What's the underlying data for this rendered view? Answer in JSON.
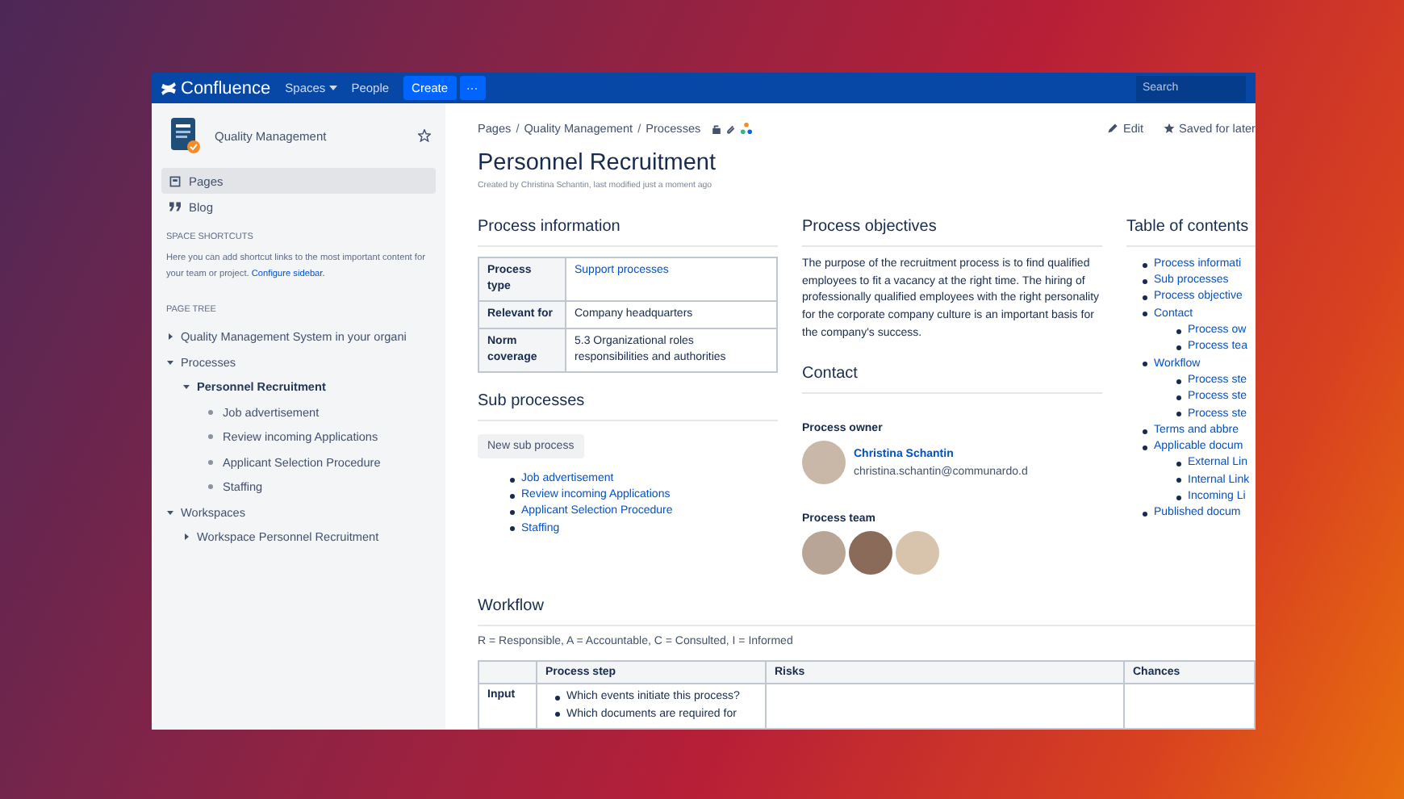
{
  "topbar": {
    "logo": "Confluence",
    "nav": [
      {
        "label": "Spaces",
        "dropdown": true
      },
      {
        "label": "People",
        "dropdown": false
      }
    ],
    "create": "Create",
    "more": "···",
    "search": {
      "placeholder": "Search"
    }
  },
  "sidebar": {
    "space_name": "Quality Management",
    "starred": false,
    "nav": [
      {
        "label": "Pages",
        "kind": "pages",
        "selected": true
      },
      {
        "label": "Blog",
        "kind": "blog",
        "selected": false
      }
    ],
    "shortcuts_heading": "SPACE SHORTCUTS",
    "shortcuts_text": "Here you can add shortcut links to the most important content for your team or project.",
    "configure_link": "Configure sidebar.",
    "tree_heading": "PAGE TREE",
    "tree": [
      {
        "label": "Quality Management System in your organi",
        "kind": "branch",
        "expanded": false,
        "selected": false
      },
      {
        "label": "Processes",
        "kind": "branch",
        "expanded": true,
        "selected": false,
        "children": [
          {
            "label": "Personnel Recruitment",
            "kind": "branch",
            "expanded": true,
            "selected": true,
            "children": [
              {
                "label": "Job advertisement",
                "kind": "leaf",
                "expanded": false,
                "selected": false
              },
              {
                "label": "Review incoming Applications",
                "kind": "leaf",
                "expanded": false,
                "selected": false
              },
              {
                "label": "Applicant Selection Procedure",
                "kind": "leaf",
                "expanded": false,
                "selected": false
              },
              {
                "label": "Staffing",
                "kind": "leaf",
                "expanded": false,
                "selected": false
              }
            ]
          }
        ]
      },
      {
        "label": "Workspaces",
        "kind": "branch",
        "expanded": true,
        "selected": false,
        "children": [
          {
            "label": "Workspace Personnel Recruitment",
            "kind": "branch",
            "expanded": false,
            "selected": false
          }
        ]
      }
    ]
  },
  "page": {
    "breadcrumbs": [
      {
        "label": "Pages",
        "kind": "link"
      },
      {
        "label": "/",
        "kind": "separator"
      },
      {
        "label": "Quality Management",
        "kind": "link"
      },
      {
        "label": "/",
        "kind": "separator"
      },
      {
        "label": "Processes",
        "kind": "link"
      }
    ],
    "actions": [
      {
        "label": "Edit",
        "kind": "edit"
      },
      {
        "label": "Saved for later",
        "kind": "saved"
      }
    ],
    "title": "Personnel Recruitment",
    "byline": "Created by Christina Schantin, last modified just a moment ago",
    "process_information": {
      "heading": "Process information",
      "rows": [
        {
          "label": "Process type",
          "value": "Support processes",
          "link": true
        },
        {
          "label": "Relevant for",
          "value": "Company headquarters",
          "link": false
        },
        {
          "label": "Norm coverage",
          "value": "5.3 Organizational roles responsibilities and authorities",
          "link": false
        }
      ]
    },
    "sub_processes": {
      "heading": "Sub processes",
      "button": "New sub process",
      "items": [
        "Job advertisement",
        "Review incoming Applications",
        "Applicant Selection Procedure",
        "Staffing"
      ]
    },
    "objectives": {
      "heading": "Process objectives",
      "text": "The purpose of the recruitment process is to find qualified employees to fit a vacancy at the right time. The hiring of professionally qualified employees with the right personality for the corporate company culture is an important basis for the company's success."
    },
    "contact": {
      "heading": "Contact",
      "owner_label": "Process owner",
      "owner_name": "Christina Schantin",
      "owner_email": "christina.schantin@communardo.d",
      "team_label": "Process team"
    },
    "toc": {
      "heading": "Table of contents",
      "items": [
        {
          "label": "Process informati"
        },
        {
          "label": "Sub processes"
        },
        {
          "label": "Process objective"
        },
        {
          "label": "Contact",
          "children": [
            {
              "label": "Process ow"
            },
            {
              "label": "Process tea"
            }
          ]
        },
        {
          "label": "Workflow",
          "children": [
            {
              "label": "Process ste"
            },
            {
              "label": "Process ste"
            },
            {
              "label": "Process ste"
            }
          ]
        },
        {
          "label": "Terms and abbre"
        },
        {
          "label": "Applicable docum",
          "children": [
            {
              "label": "External Lin"
            },
            {
              "label": "Internal Link"
            },
            {
              "label": "Incoming Li"
            }
          ]
        },
        {
          "label": "Published docum"
        }
      ]
    },
    "workflow": {
      "heading": "Workflow",
      "legend": "R = Responsible, A = Accountable, C = Consulted, I = Informed",
      "columns": [
        "Process step",
        "Risks",
        "Chances"
      ],
      "rows": [
        {
          "label": "Input",
          "process_step": [
            "Which events initiate this process?",
            "Which documents are required for"
          ]
        }
      ]
    }
  }
}
